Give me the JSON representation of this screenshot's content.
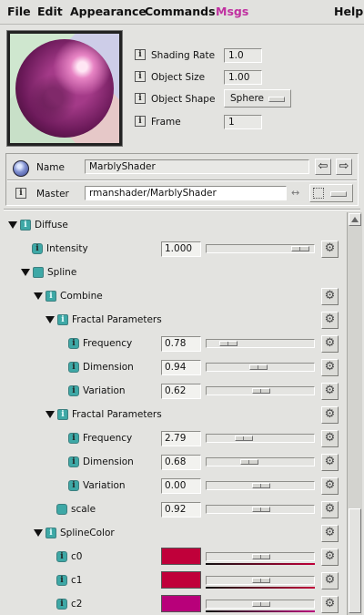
{
  "menu": {
    "items": [
      "File",
      "Edit",
      "Appearance",
      "Commands",
      "Msgs"
    ],
    "help": "Help",
    "active_index": 4,
    "active_color": "#c030a0"
  },
  "header": {
    "shading_rate": {
      "label": "Shading Rate",
      "value": "1.0"
    },
    "object_size": {
      "label": "Object Size",
      "value": "1.00"
    },
    "object_shape": {
      "label": "Object Shape",
      "value": "Sphere"
    },
    "frame": {
      "label": "Frame",
      "value": "1"
    },
    "info_glyph": "i"
  },
  "identity": {
    "name_label": "Name",
    "name_value": "MarblyShader",
    "master_label": "Master",
    "master_value": "rmanshader/MarblyShader",
    "back_glyph": "⇦",
    "forward_glyph": "⇨",
    "link_glyph": "↔"
  },
  "tree": {
    "rows": [
      {
        "label": "Diffuse",
        "level": 0,
        "kind": "group",
        "expanded": true,
        "icon": "info"
      },
      {
        "label": "Intensity",
        "level": 1,
        "kind": "param",
        "value": "1.000",
        "slider": 0.95
      },
      {
        "label": "Spline",
        "level": 1,
        "kind": "group",
        "expanded": true,
        "icon": "box"
      },
      {
        "label": "Combine",
        "level": 2,
        "kind": "group",
        "expanded": true,
        "icon": "info"
      },
      {
        "label": "Fractal Parameters",
        "level": 3,
        "kind": "group",
        "expanded": true,
        "icon": "info"
      },
      {
        "label": "Frequency",
        "level": 4,
        "kind": "param",
        "value": "0.78",
        "slider": 0.12
      },
      {
        "label": "Dimension",
        "level": 4,
        "kind": "param",
        "value": "0.94",
        "slider": 0.47
      },
      {
        "label": "Variation",
        "level": 4,
        "kind": "param",
        "value": "0.62",
        "slider": 0.5
      },
      {
        "label": "Fractal Parameters",
        "level": 3,
        "kind": "group",
        "expanded": true,
        "icon": "info"
      },
      {
        "label": "Frequency",
        "level": 4,
        "kind": "param",
        "value": "2.79",
        "slider": 0.3
      },
      {
        "label": "Dimension",
        "level": 4,
        "kind": "param",
        "value": "0.68",
        "slider": 0.36
      },
      {
        "label": "Variation",
        "level": 4,
        "kind": "param",
        "value": "0.00",
        "slider": 0.5
      },
      {
        "label": "scale",
        "level": 3,
        "kind": "param",
        "value": "0.92",
        "slider": 0.5,
        "icon": "teal"
      },
      {
        "label": "SplineColor",
        "level": 2,
        "kind": "group",
        "expanded": true,
        "icon": "info"
      },
      {
        "label": "c0",
        "level": 3,
        "kind": "color",
        "color": "#c0003a",
        "slider": 0.5
      },
      {
        "label": "c1",
        "level": 3,
        "kind": "color",
        "color": "#c0003a",
        "slider": 0.5
      },
      {
        "label": "c2",
        "level": 3,
        "kind": "color",
        "color": "#b8007a",
        "slider": 0.5
      }
    ]
  },
  "icons": {
    "gear": "gear-icon",
    "info": "info-icon",
    "expand": "triangle-down-icon"
  },
  "gear_glyph": "⚙"
}
